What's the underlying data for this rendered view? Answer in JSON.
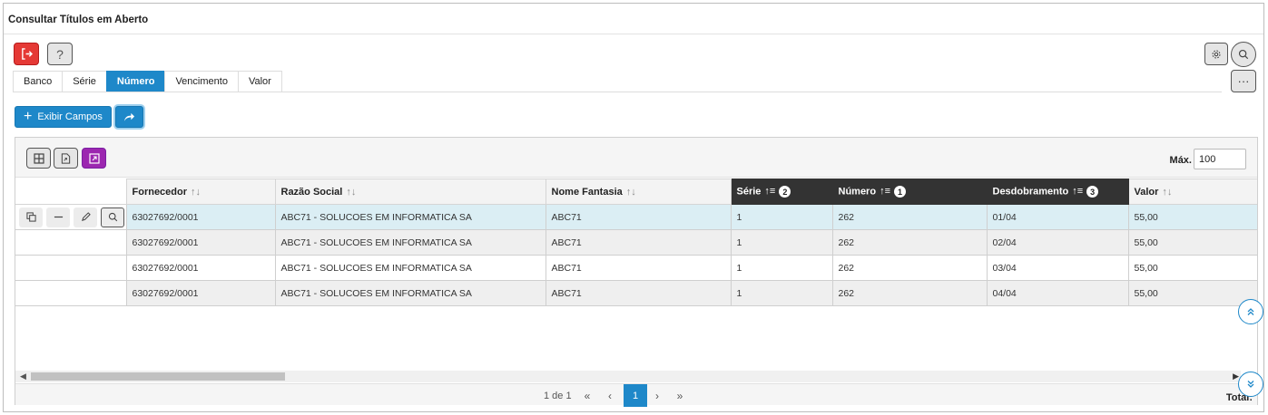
{
  "window": {
    "title": "Consultar Títulos em Aberto"
  },
  "header": {
    "help_label": "?",
    "more_label": "···"
  },
  "tabs": [
    {
      "label": "Banco",
      "active": false
    },
    {
      "label": "Série",
      "active": false
    },
    {
      "label": "Número",
      "active": true
    },
    {
      "label": "Vencimento",
      "active": false
    },
    {
      "label": "Valor",
      "active": false
    }
  ],
  "actions": {
    "exibir_campos_label": "Exibir Campos"
  },
  "grid": {
    "max_label": "Máx.",
    "max_value": "100",
    "columns": [
      {
        "label": "Fornecedor",
        "sort_order": ""
      },
      {
        "label": "Razão Social",
        "sort_order": ""
      },
      {
        "label": "Nome Fantasia",
        "sort_order": ""
      },
      {
        "label": "Série",
        "sort_order": "2"
      },
      {
        "label": "Número",
        "sort_order": "1"
      },
      {
        "label": "Desdobramento",
        "sort_order": "3"
      },
      {
        "label": "Valor",
        "sort_order": ""
      }
    ],
    "rows": [
      [
        "63027692/0001",
        "ABC71 - SOLUCOES EM INFORMATICA SA",
        "ABC71",
        "1",
        "262",
        "01/04",
        "55,00"
      ],
      [
        "63027692/0001",
        "ABC71 - SOLUCOES EM INFORMATICA SA",
        "ABC71",
        "1",
        "262",
        "02/04",
        "55,00"
      ],
      [
        "63027692/0001",
        "ABC71 - SOLUCOES EM INFORMATICA SA",
        "ABC71",
        "1",
        "262",
        "03/04",
        "55,00"
      ],
      [
        "63027692/0001",
        "ABC71 - SOLUCOES EM INFORMATICA SA",
        "ABC71",
        "1",
        "262",
        "04/04",
        "55,00"
      ]
    ]
  },
  "pager": {
    "info": "1 de 1",
    "current_page": "1",
    "first": "«",
    "prev": "‹",
    "next": "›",
    "last": "»",
    "total_label": "Total:"
  },
  "colors": {
    "accent": "#1e88c9",
    "exit": "#e53935",
    "purple": "#9c27b0",
    "sorted_header": "#333333",
    "selected_row": "#dbeef4"
  }
}
